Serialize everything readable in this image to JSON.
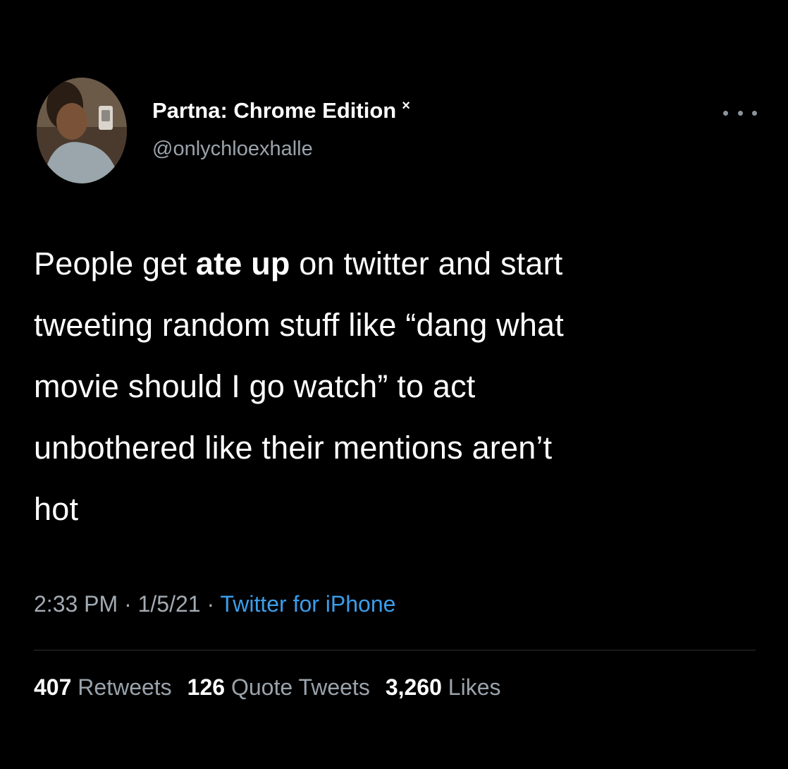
{
  "author": {
    "display_name": "Partna: Chrome Edition",
    "badge": "×",
    "handle": "@onlychloexhalle"
  },
  "tweet": {
    "lines": [
      {
        "pre": "People get ",
        "bold": "ate up",
        "post": " on twitter and start"
      },
      {
        "text": "tweeting random stuff like “dang what"
      },
      {
        "text": "movie should I go watch” to act"
      },
      {
        "text": "unbothered like their mentions aren’t"
      },
      {
        "text": "hot"
      }
    ]
  },
  "meta": {
    "time": "2:33 PM",
    "separator": "·",
    "date": "1/5/21",
    "source": "Twitter for iPhone"
  },
  "stats": {
    "retweets_count": "407",
    "retweets_label": "Retweets",
    "quotes_count": "126",
    "quotes_label": "Quote Tweets",
    "likes_count": "3,260",
    "likes_label": "Likes"
  },
  "icons": {
    "avatar": "profile-photo",
    "more": "more-options-icon"
  },
  "colors": {
    "background": "#000000",
    "primary_text": "#ffffff",
    "secondary_text": "#9aa3ab",
    "link": "#3b9dea"
  }
}
